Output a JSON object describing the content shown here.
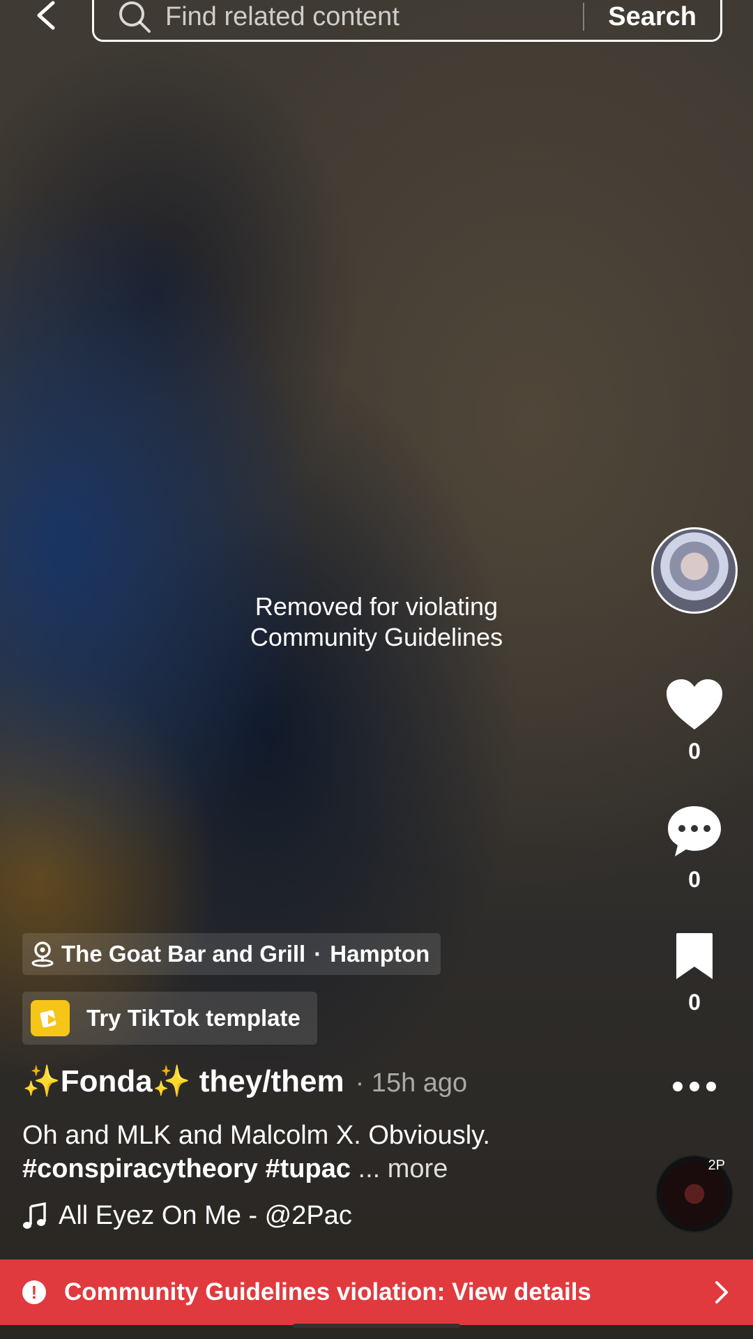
{
  "search": {
    "placeholder": "Find related content",
    "button_label": "Search"
  },
  "video": {
    "removed_line1": "Removed for violating",
    "removed_line2": "Community Guidelines"
  },
  "rail": {
    "like_count": "0",
    "comment_count": "0",
    "bookmark_count": "0",
    "disc_tag": "2P"
  },
  "location": {
    "place": "The Goat Bar and Grill",
    "separator": "·",
    "city": "Hampton"
  },
  "template": {
    "label": "Try TikTok template"
  },
  "post": {
    "author": "✨Fonda✨ they/them",
    "time": "· 15h ago",
    "caption_text": "Oh and MLK and Malcolm X. Obviously.",
    "caption_tags": "#conspiracytheory #tupac",
    "more_label": "... more"
  },
  "sound": {
    "label": "All Eyez On Me - @2Pac"
  },
  "banner": {
    "text": "Community Guidelines violation: View details"
  },
  "colors": {
    "banner_red": "#e03a3e",
    "template_yellow": "#f5c518"
  },
  "icons": [
    "back-icon",
    "search-icon",
    "heart-icon",
    "comment-icon",
    "bookmark-icon",
    "more-icon",
    "location-pin-icon",
    "template-icon",
    "music-note-icon",
    "warning-icon",
    "chevron-right-icon"
  ]
}
